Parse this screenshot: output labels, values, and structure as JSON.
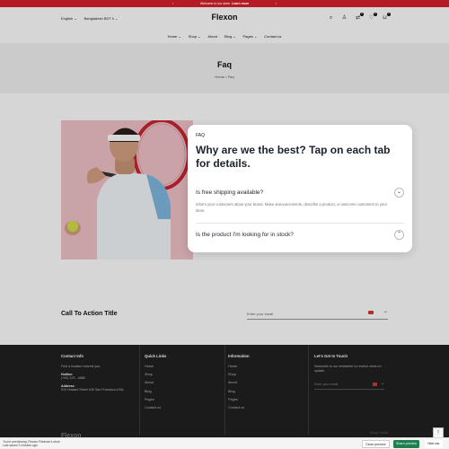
{
  "announcement": {
    "text": "Welcome to our store",
    "link": "Learn more"
  },
  "header": {
    "language": "English",
    "currency": "Bangladesh BDT ৳",
    "logo": "Flexon",
    "icons": [
      "search-icon",
      "user-icon",
      "compare-icon",
      "wishlist-icon",
      "cart-icon"
    ],
    "counts": {
      "compare": "0",
      "wishlist": "0",
      "cart": "0"
    }
  },
  "nav": {
    "items": [
      "Home",
      "Shop",
      "About",
      "Blog",
      "Pages",
      "Contact us"
    ]
  },
  "page_header": {
    "title": "Faq",
    "crumb_home": "Home",
    "crumb_sep": "•",
    "crumb_current": "Faq"
  },
  "faq": {
    "tag": "FAQ",
    "heading": "Why are we the best? Tap on each tab for details.",
    "items": [
      {
        "question": "Is free shipping available?",
        "answer": "Inform your customers about your brand. Make announcements, describe a product, or welcome customers to your store.",
        "toggle": "⌄"
      },
      {
        "question": "Is the product I'm looking for in stock?",
        "toggle": "⌃"
      }
    ]
  },
  "cta": {
    "title": "Call To Action Title",
    "placeholder": "Enter your email"
  },
  "footer": {
    "contact": {
      "title": "Contact Info",
      "find": "Find a location nearest you.",
      "hotline_label": "Hotline:",
      "hotline": "(+00) 123 - 4888",
      "address_label": "Address:",
      "address": "910 Howard Street #30 San Francisco,USA."
    },
    "quick_links": {
      "title": "Quick Links",
      "items": [
        "Home",
        "Shop",
        "About",
        "Blog",
        "Pages",
        "Contact us"
      ]
    },
    "information": {
      "title": "Information",
      "items": [
        "Home",
        "Shop",
        "About",
        "Blog",
        "Pages",
        "Contact us"
      ]
    },
    "touch": {
      "title": "Let's Get In Touch",
      "text": "Subscribe to our newsletter to receive news on update.",
      "placeholder": "Enter your email"
    },
    "bottom_logo": "Flexon",
    "bottom_right": "Shop Sushi"
  },
  "preview_bar": {
    "line1": "You're previewing: Rezaur Rahman's store",
    "line2": "Last saved 3 minutes ago",
    "buttons": [
      "Close preview",
      "Share preview",
      "Hide bar"
    ]
  },
  "colors": {
    "announcement": "#b51b24",
    "footer": "#212121",
    "share_button": "#1f7f4f"
  }
}
